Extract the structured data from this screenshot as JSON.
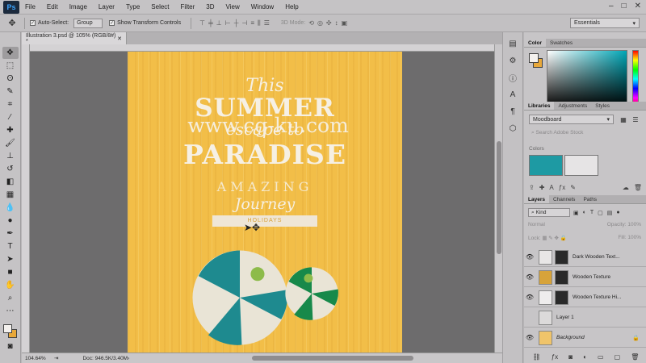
{
  "app": {
    "logo": "Ps"
  },
  "menu": [
    "File",
    "Edit",
    "Image",
    "Layer",
    "Type",
    "Select",
    "Filter",
    "3D",
    "View",
    "Window",
    "Help"
  ],
  "window_controls": {
    "minimize": "–",
    "maximize": "□",
    "close": "✕"
  },
  "options_bar": {
    "auto_select_label": "Auto-Select:",
    "auto_select_value": "Group",
    "transform_label": "Show Transform Controls",
    "mode_3d": "3D Mode:",
    "workspace": "Essentials"
  },
  "document": {
    "tab_title": "Illustration 3.psd @ 105% (RGB/8#) *",
    "zoom": "104.64%",
    "doc_info": "Doc: 946.5K/3.40M"
  },
  "artwork": {
    "line1": "This",
    "line2": "SUMMER",
    "line3": "escape to",
    "line4": "PARADISE",
    "line5": "AMAZING",
    "line6": "Journey",
    "ribbon": "HOLIDAYS",
    "watermark": "www.cg-ku.com"
  },
  "colors": {
    "foreground": "#f4f1ee",
    "background": "#e8a83a",
    "canvas": "#f2be48",
    "ball_teal": "#1e8a8f",
    "ball_green": "#17894a"
  },
  "panels": {
    "color_tabs": [
      "Color",
      "Swatches"
    ],
    "library_tabs": [
      "Libraries",
      "Adjustments",
      "Styles"
    ],
    "library_name": "Moodboard",
    "library_search_placeholder": "Search Adobe Stock",
    "library_colors_header": "Colors",
    "layers_tabs": [
      "Layers",
      "Channels",
      "Paths"
    ],
    "layer_kind": "Kind",
    "blend_mode": "Normal",
    "opacity_label": "Opacity:",
    "opacity_value": "100%",
    "lock_label": "Lock:",
    "fill_label": "Fill:",
    "fill_value": "100%"
  },
  "layers": [
    {
      "name": "Dark Wooden Text...",
      "thumb": "#e8e6e6"
    },
    {
      "name": "Wooden Texture",
      "thumb": "#d7a33a"
    },
    {
      "name": "Wooden Texture Hi...",
      "thumb": "#efeded"
    },
    {
      "name": "Layer 1",
      "thumb": "#dcdada"
    },
    {
      "name": "Background",
      "thumb": "#f0c46a"
    }
  ]
}
